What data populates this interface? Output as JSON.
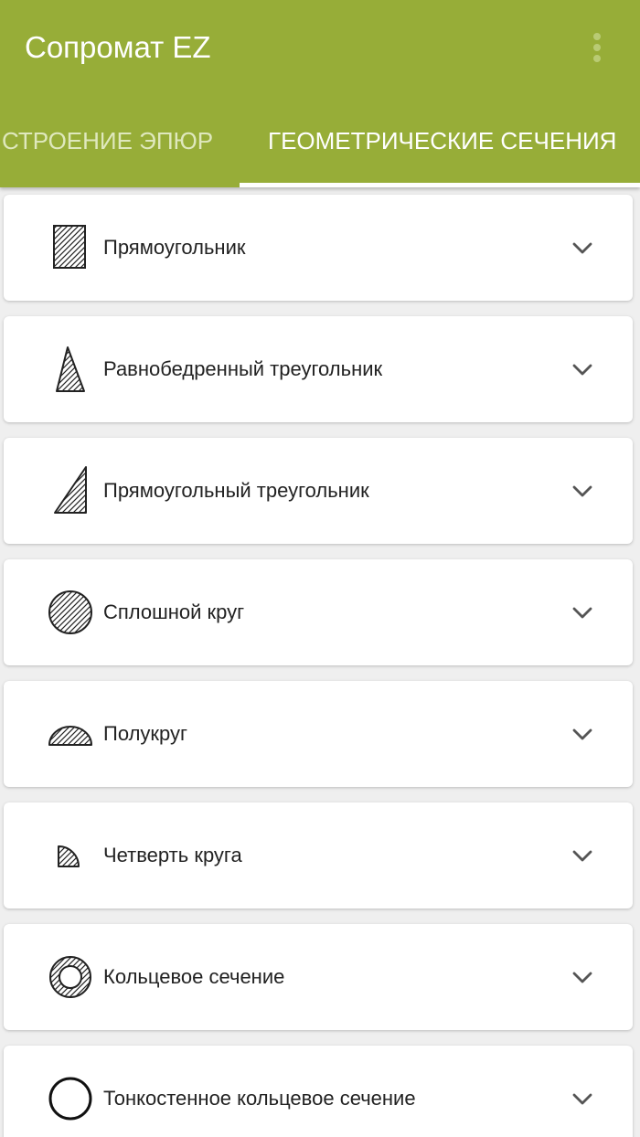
{
  "app": {
    "title": "Сопромат EZ",
    "menu_icon": "more-vert-icon"
  },
  "colors": {
    "primary": "#97ad38",
    "tab_active": "#ffffff",
    "tab_inactive": "#dfe8bd",
    "background": "#efefef",
    "card": "#ffffff",
    "text": "#222222",
    "chevron": "#555555"
  },
  "tabs": [
    {
      "label": "СТРОЕНИЕ ЭПЮР",
      "active": false
    },
    {
      "label": "ГЕОМЕТРИЧЕСКИЕ СЕЧЕНИЯ",
      "active": true
    }
  ],
  "sections": [
    {
      "label": "Прямоугольник",
      "icon": "hatched-rectangle-icon"
    },
    {
      "label": "Равнобедренный треугольник",
      "icon": "hatched-isosceles-triangle-icon"
    },
    {
      "label": "Прямоугольный треугольник",
      "icon": "hatched-right-triangle-icon"
    },
    {
      "label": "Сплошной круг",
      "icon": "hatched-circle-icon"
    },
    {
      "label": "Полукруг",
      "icon": "hatched-semicircle-icon"
    },
    {
      "label": "Четверть круга",
      "icon": "hatched-quarter-circle-icon"
    },
    {
      "label": "Кольцевое сечение",
      "icon": "hatched-annulus-icon"
    },
    {
      "label": "Тонкостенное кольцевое сечение",
      "icon": "thin-ring-icon"
    }
  ]
}
